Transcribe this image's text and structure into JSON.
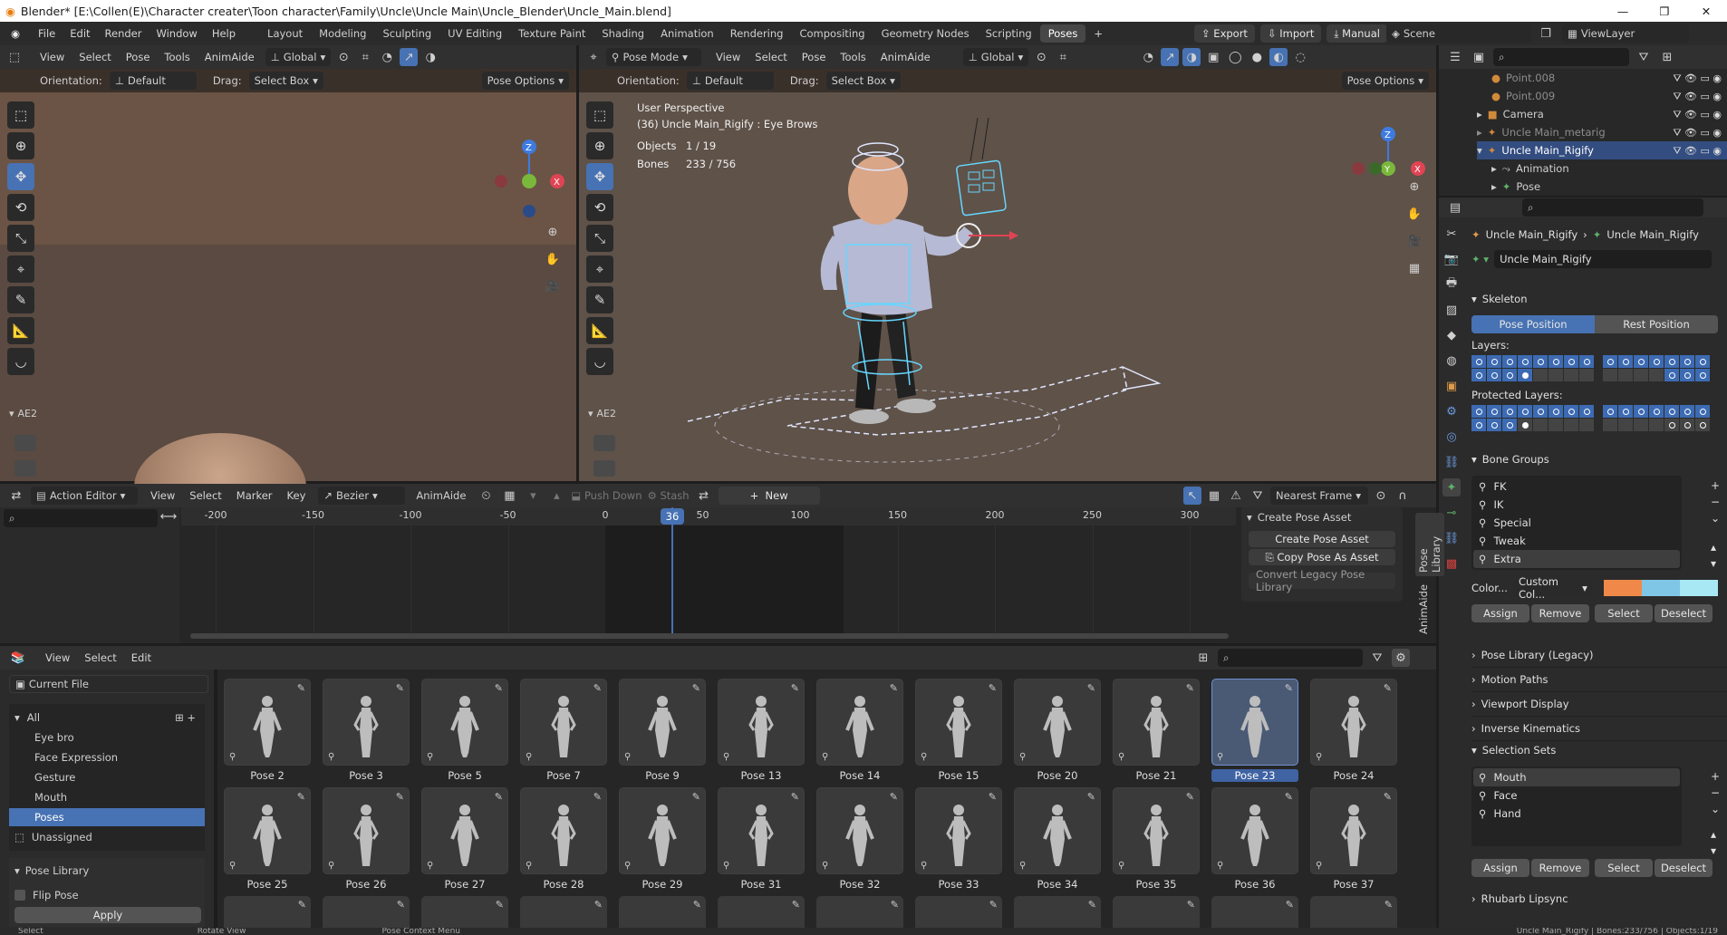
{
  "window": {
    "title": "Blender* [E:\\Collen(E)\\Character creater\\Toon character\\Family\\Uncle\\Uncle Main\\Uncle_Blender\\Uncle_Main.blend]"
  },
  "menubar": {
    "items": [
      "File",
      "Edit",
      "Render",
      "Window",
      "Help"
    ]
  },
  "workspaces": [
    "Layout",
    "Modeling",
    "Sculpting",
    "UV Editing",
    "Texture Paint",
    "Shading",
    "Animation",
    "Rendering",
    "Compositing",
    "Geometry Nodes",
    "Scripting",
    "Poses"
  ],
  "active_workspace": "Poses",
  "top_right": {
    "export": "Export",
    "import": "Import",
    "manual": "Manual",
    "scene": "Scene",
    "viewlayer": "ViewLayer"
  },
  "left_viewport": {
    "menus": [
      "View",
      "Select",
      "Pose",
      "Tools",
      "AnimAide"
    ],
    "transform": "Global",
    "orientation_label": "Orientation:",
    "orientation_value": "Default",
    "drag_label": "Drag:",
    "drag_value": "Select Box",
    "options": "Pose Options",
    "panel": "AE2"
  },
  "main_viewport": {
    "mode": "Pose Mode",
    "menus": [
      "View",
      "Select",
      "Pose",
      "Tools",
      "AnimAide"
    ],
    "transform": "Global",
    "orientation_label": "Orientation:",
    "orientation_value": "Default",
    "drag_label": "Drag:",
    "drag_value": "Select Box",
    "options": "Pose Options",
    "perspective": "User Perspective",
    "active": "(36) Uncle Main_Rigify : Eye Brows",
    "objects_label": "Objects",
    "objects_value": "1 / 19",
    "bones_label": "Bones",
    "bones_value": "233 / 756",
    "panel": "AE2"
  },
  "outliner": {
    "items": [
      {
        "label": "Point.008"
      },
      {
        "label": "Point.009"
      },
      {
        "label": "Camera"
      },
      {
        "label": "Uncle Main_metarig"
      },
      {
        "label": "Uncle Main_Rigify",
        "selected": true
      },
      {
        "label": "Animation"
      },
      {
        "label": "Pose"
      }
    ]
  },
  "action_editor": {
    "mode": "Action Editor",
    "menus": [
      "View",
      "Select",
      "Marker",
      "Key"
    ],
    "interp": "Bezier",
    "animaide": "AnimAide",
    "push_down": "Push Down",
    "stash": "Stash",
    "new": "New",
    "snap": "Nearest Frame",
    "current_frame": "36",
    "ruler": [
      "-200",
      "-150",
      "-100",
      "-50",
      "0",
      "50",
      "100",
      "150",
      "200",
      "250",
      "300"
    ],
    "side_tabs": [
      "Pose Library",
      "AnimAide"
    ],
    "panel": {
      "title": "Create Pose Asset",
      "create": "Create Pose Asset",
      "copy": "Copy Pose As Asset",
      "convert": "Convert Legacy Pose Library"
    }
  },
  "asset_browser": {
    "menus": [
      "View",
      "Select",
      "Edit"
    ],
    "library": "Current File",
    "catalogs": [
      {
        "label": "All"
      },
      {
        "label": "Eye bro"
      },
      {
        "label": "Face Expression"
      },
      {
        "label": "Gesture"
      },
      {
        "label": "Mouth"
      },
      {
        "label": "Poses",
        "active": true
      },
      {
        "label": "Unassigned"
      }
    ],
    "pose_library_panel": "Pose Library",
    "flip_pose": "Flip Pose",
    "apply": "Apply",
    "poses": [
      "Pose 2",
      "Pose 3",
      "Pose 5",
      "Pose 7",
      "Pose 9",
      "Pose 13",
      "Pose 14",
      "Pose 15",
      "Pose 20",
      "Pose 21",
      "Pose 23",
      "Pose 24",
      "Pose 25",
      "Pose 26",
      "Pose 27",
      "Pose 28",
      "Pose 29",
      "Pose 31",
      "Pose 32",
      "Pose 33",
      "Pose 34",
      "Pose 35",
      "Pose 36",
      "Pose 37"
    ],
    "selected_pose": "Pose 23"
  },
  "properties": {
    "breadcrumb": [
      "Uncle Main_Rigify",
      "Uncle Main_Rigify"
    ],
    "armature": "Uncle Main_Rigify",
    "skeleton": "Skeleton",
    "pose_position": "Pose Position",
    "rest_position": "Rest Position",
    "layers": "Layers:",
    "protected_layers": "Protected Layers:",
    "bone_groups": "Bone Groups",
    "groups": [
      "FK",
      "IK",
      "Special",
      "Tweak",
      "Extra"
    ],
    "color_label": "Color...",
    "color_set": "Custom Col...",
    "colors": [
      "#f0884a",
      "#7fc6e6",
      "#a8e8f5"
    ],
    "assign": "Assign",
    "remove": "Remove",
    "select": "Select",
    "deselect": "Deselect",
    "collapsed": [
      "Pose Library (Legacy)",
      "Motion Paths",
      "Viewport Display",
      "Inverse Kinematics"
    ],
    "selection_sets": "Selection Sets",
    "sets": [
      "Mouth",
      "Face",
      "Hand"
    ],
    "rhubarb": "Rhubarb Lipsync"
  },
  "statusbar": {
    "select": "Select",
    "rotate": "Rotate View",
    "context": "Pose Context Menu",
    "info": "Uncle Main_Rigify | Bones:233/756 | Objects:1/19"
  }
}
